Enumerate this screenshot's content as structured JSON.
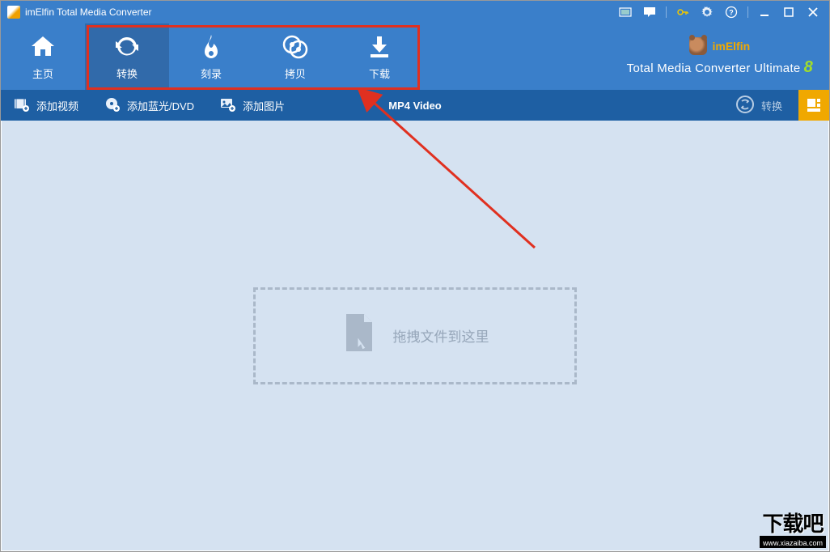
{
  "titlebar": {
    "title": "imElfin Total Media Converter"
  },
  "mainnav": {
    "home_label": "主页",
    "convert_label": "转换",
    "burn_label": "刻录",
    "copy_label": "拷贝",
    "download_label": "下载"
  },
  "brand": {
    "name": "imElfin",
    "product": "Total Media Converter Ultimate",
    "version_glyph": "8"
  },
  "toolbar": {
    "add_video_label": "添加视频",
    "add_bluray_label": "添加蓝光/DVD",
    "add_image_label": "添加图片",
    "format_label": "MP4 Video",
    "convert_label": "转换"
  },
  "content": {
    "dropzone_text": "拖拽文件到这里"
  },
  "watermark": {
    "text": "下载吧",
    "url": "www.xiazaiba.com"
  }
}
